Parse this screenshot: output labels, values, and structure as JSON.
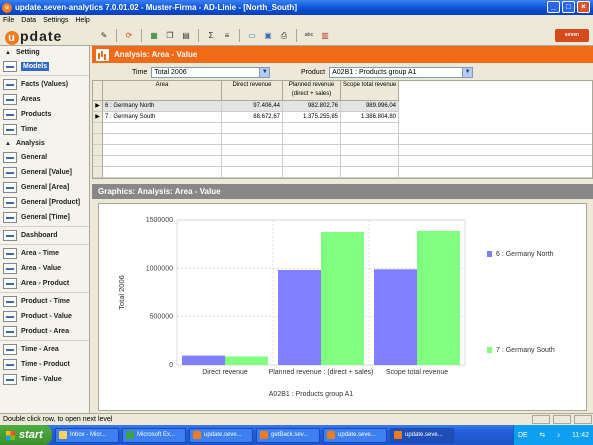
{
  "window": {
    "title": "update.seven-analytics 7.0.01.02 - Muster-Firma - AD-Linie - [North_South]",
    "min": "_",
    "max": "□",
    "close": "×"
  },
  "menu": [
    "File",
    "Data",
    "Settings",
    "Help"
  ],
  "toolbar": {
    "logo_u": "u",
    "logo_rest": "pdate",
    "brand": "seven"
  },
  "sidebar": {
    "setting_header": "Setting",
    "models": "Models",
    "items_a": [
      "Facts (Values)",
      "Areas",
      "Products",
      "Time"
    ],
    "analysis_header": "Analysis",
    "items_b": [
      "General",
      "General [Value]",
      "General [Area]",
      "General [Product]",
      "General [Time]"
    ],
    "dashboard": "Dashboard",
    "items_c": [
      "Area - Time",
      "Area - Value",
      "Area - Product"
    ],
    "items_d": [
      "Product - Time",
      "Product - Value",
      "Product - Area"
    ],
    "items_e": [
      "Time - Area",
      "Time - Product",
      "Time - Value"
    ]
  },
  "analysis": {
    "title": "Analysis: Area - Value",
    "time_label": "Time",
    "time_value": "Total 2006",
    "product_label": "Product",
    "product_value": "A02B1 : Products group A1"
  },
  "grid": {
    "headers": [
      "Area",
      "Direct revenue",
      "Planned revenue\n(direct + sales)",
      "Scope total revenue"
    ],
    "header_area": "Area",
    "header_direct": "Direct revenue",
    "header_planned_1": "Planned revenue",
    "header_planned_2": "(direct + sales)",
    "header_scope": "Scope total revenue",
    "rows": [
      {
        "marker": "▶",
        "area": "6 : Germany North",
        "direct": "97.406,44",
        "planned": "982.802,76",
        "scope": "989.996,04"
      },
      {
        "marker": "▶",
        "area": "7 : Germany South",
        "direct": "88.672,67",
        "planned": "1.375.255,85",
        "scope": "1.386.804,80"
      }
    ]
  },
  "graphics": {
    "title": "Graphics: Analysis: Area - Value"
  },
  "chart_data": {
    "type": "bar",
    "categories": [
      "Direct revenue",
      "Planned revenue : (direct + sales)",
      "Scope total revenue"
    ],
    "series": [
      {
        "name": "6 : Germany North",
        "color": "#8080ff",
        "values": [
          97406.44,
          982802.76,
          989996.04
        ]
      },
      {
        "name": "7 : Germany South",
        "color": "#80ff80",
        "values": [
          88672.67,
          1375255.85,
          1386804.8
        ]
      }
    ],
    "ylabel": "Total 2006",
    "xlabel": "A02B1 : Products group A1",
    "ylim": [
      0,
      1500000
    ],
    "yticks": [
      "0",
      "500000",
      "1000000",
      "1500000"
    ],
    "grid": true,
    "legend": "right"
  },
  "status": {
    "text": "Double click row, to open next level"
  },
  "taskbar": {
    "start": "start",
    "buttons": [
      "Inbox - Micr...",
      "Microsoft Ex...",
      "update.seve...",
      "getBack.sev...",
      "update.seve...",
      "update.seve..."
    ],
    "lang": "DE",
    "clock": "11:42"
  }
}
